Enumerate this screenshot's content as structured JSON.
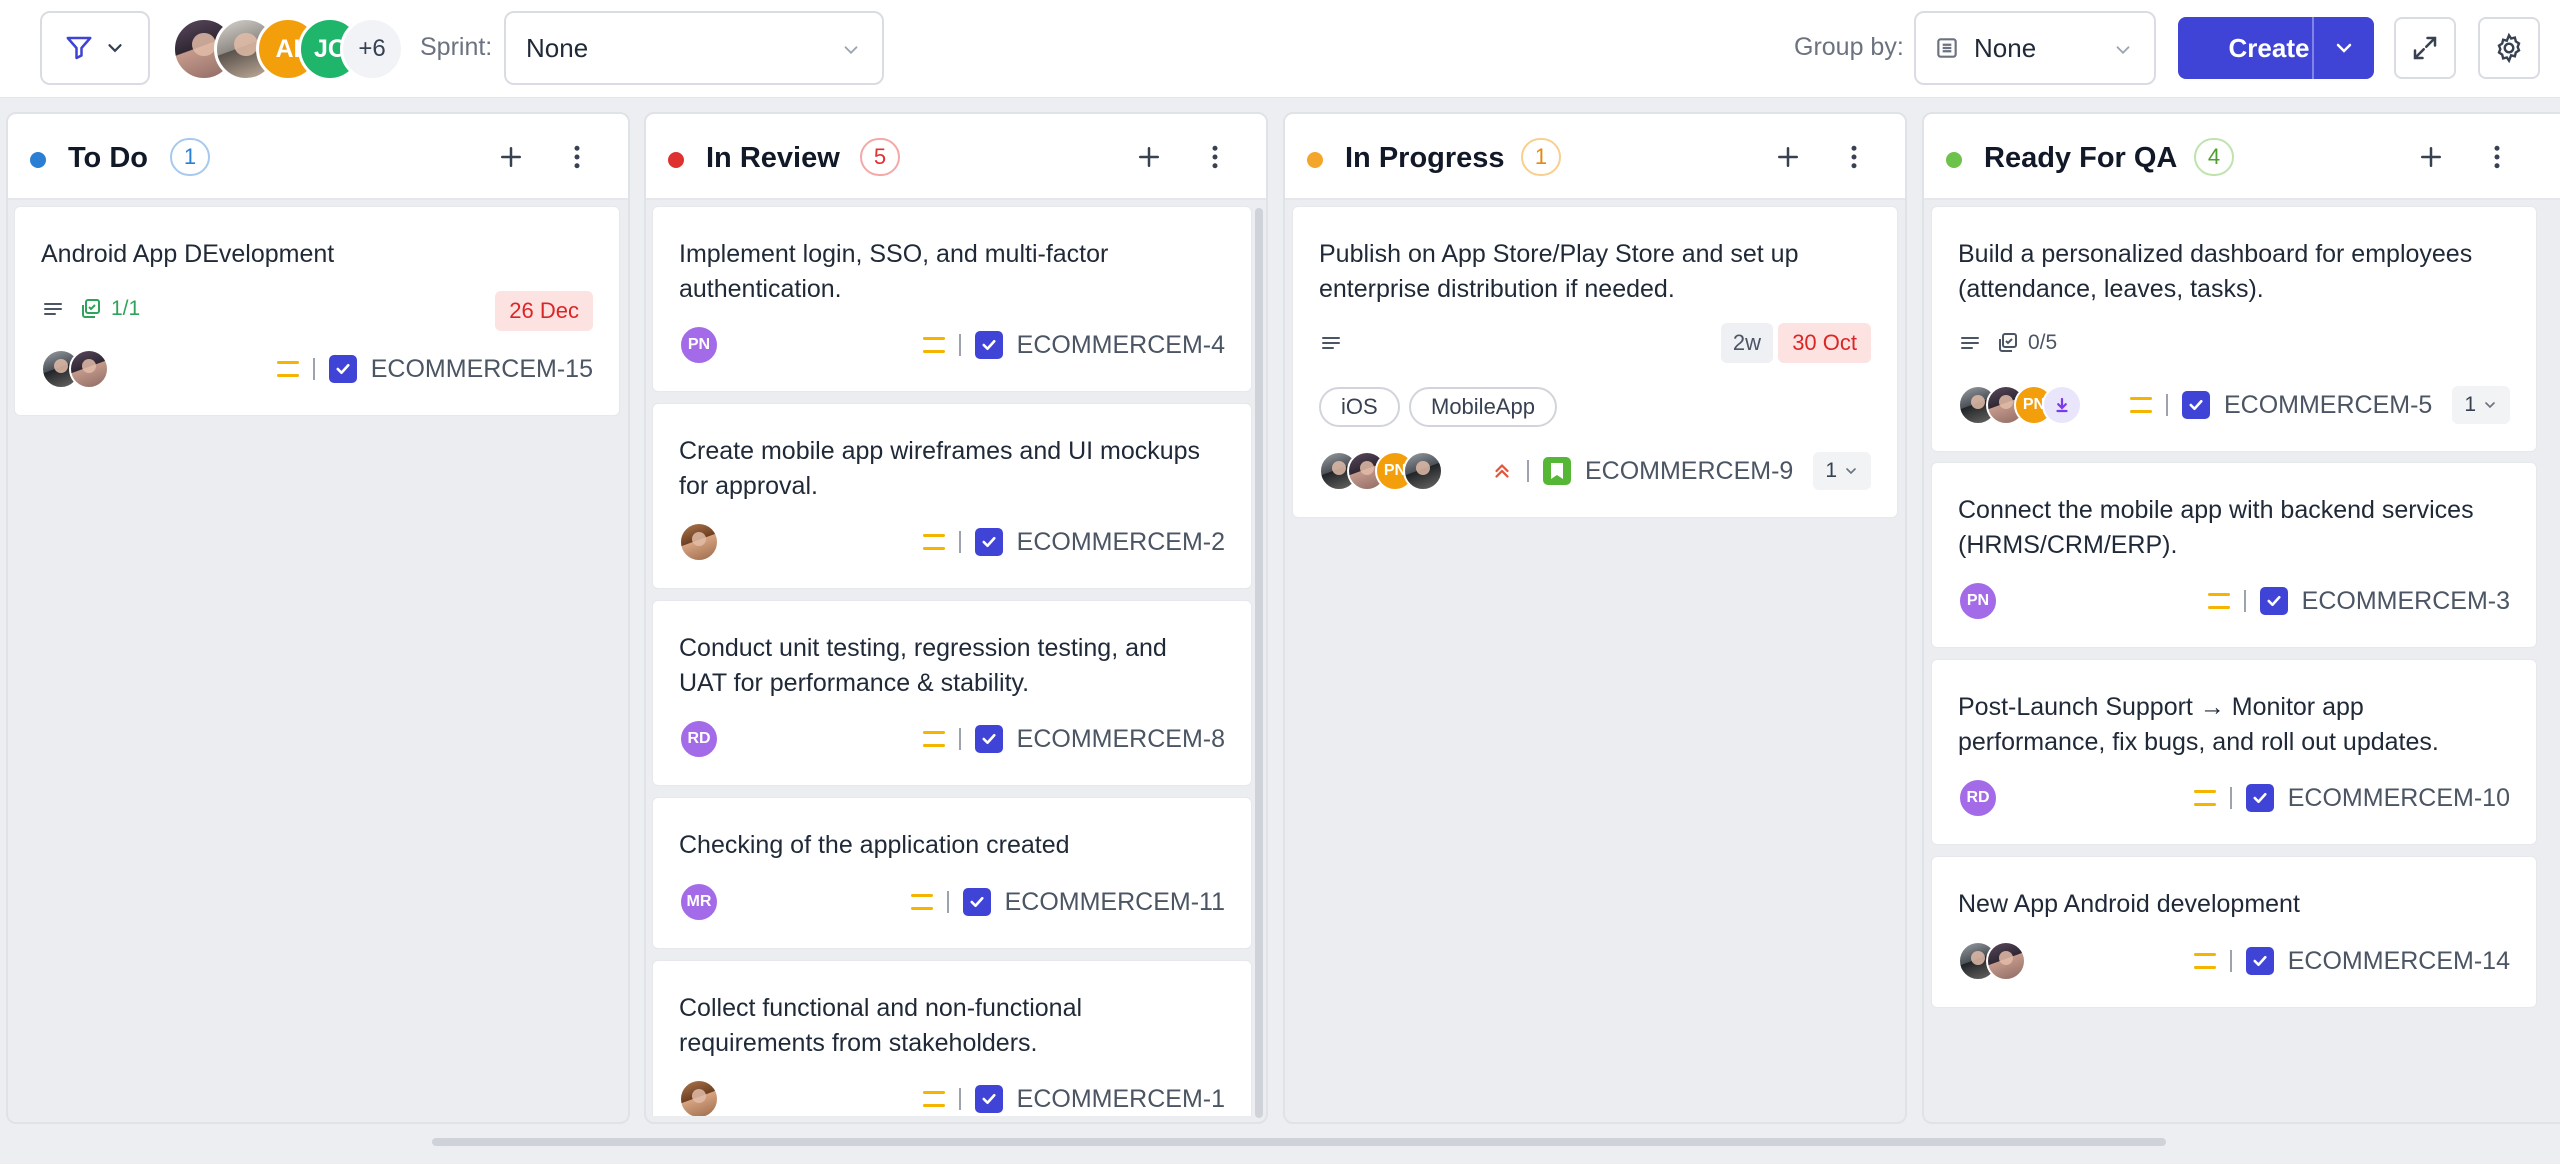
{
  "toolbar": {
    "filter_icon": "filter-icon",
    "avatars": [
      {
        "type": "photo",
        "style": "ph1",
        "label": ""
      },
      {
        "type": "photo",
        "style": "ph2",
        "label": ""
      },
      {
        "type": "initials",
        "label": "AI",
        "color": "#f29f0b"
      },
      {
        "type": "initials",
        "label": "JC",
        "color": "#1fb56b"
      }
    ],
    "more_count": "+6",
    "sprint_label": "Sprint:",
    "sprint_value": "None",
    "group_label": "Group by:",
    "group_value": "None",
    "create_label": "Create"
  },
  "colors": {
    "accent": "#3f43d6",
    "todo": "#2a7fd4",
    "review": "#e03131",
    "progress": "#f4a62a",
    "qa": "#6cc24a",
    "date_badge_bg": "#fde2e2",
    "date_badge_fg": "#dc2626",
    "priority": "#f4b400"
  },
  "columns": [
    {
      "title": "To Do",
      "count": "1",
      "cards": [
        {
          "title": "Android App DEvelopment",
          "subtasks": "1/1",
          "date": "26 Dec",
          "key": "ECOMMERCEM-15"
        }
      ]
    },
    {
      "title": "In Review",
      "count": "5",
      "cards": [
        {
          "title": "Implement login, SSO, and multi-factor authentication.",
          "assignee": "PN",
          "key": "ECOMMERCEM-4"
        },
        {
          "title": "Create mobile app wireframes and UI mockups for approval.",
          "assignee": "",
          "key": "ECOMMERCEM-2"
        },
        {
          "title": "Conduct unit testing, regression testing, and UAT for performance & stability.",
          "assignee": "RD",
          "key": "ECOMMERCEM-8"
        },
        {
          "title": "Checking of the application created",
          "assignee": "MR",
          "key": "ECOMMERCEM-11"
        },
        {
          "title": "Collect functional and non-functional requirements from stakeholders.",
          "assignee": "",
          "key": "ECOMMERCEM-1"
        }
      ]
    },
    {
      "title": "In Progress",
      "count": "1",
      "cards": [
        {
          "title": "Publish on App Store/Play Store and set up enterprise distribution if needed.",
          "estimate": "2w",
          "date": "30 Oct",
          "tags": [
            "iOS",
            "MobileApp"
          ],
          "avatar_initials": "PN",
          "key": "ECOMMERCEM-9",
          "child_count": "1"
        }
      ]
    },
    {
      "title": "Ready For QA",
      "count": "4",
      "cards": [
        {
          "title": "Build a personalized dashboard for employees (attendance, leaves, tasks).",
          "subtasks": "0/5",
          "avatar_initials": "PN",
          "key": "ECOMMERCEM-5",
          "child_count": "1"
        },
        {
          "title": "Connect the mobile app with backend services (HRMS/CRM/ERP).",
          "assignee": "PN",
          "key": "ECOMMERCEM-3"
        },
        {
          "title": "Post-Launch Support → Monitor app performance, fix bugs, and roll out updates.",
          "assignee": "RD",
          "key": "ECOMMERCEM-10"
        },
        {
          "title": "New App Android development",
          "key": "ECOMMERCEM-14"
        }
      ]
    }
  ]
}
